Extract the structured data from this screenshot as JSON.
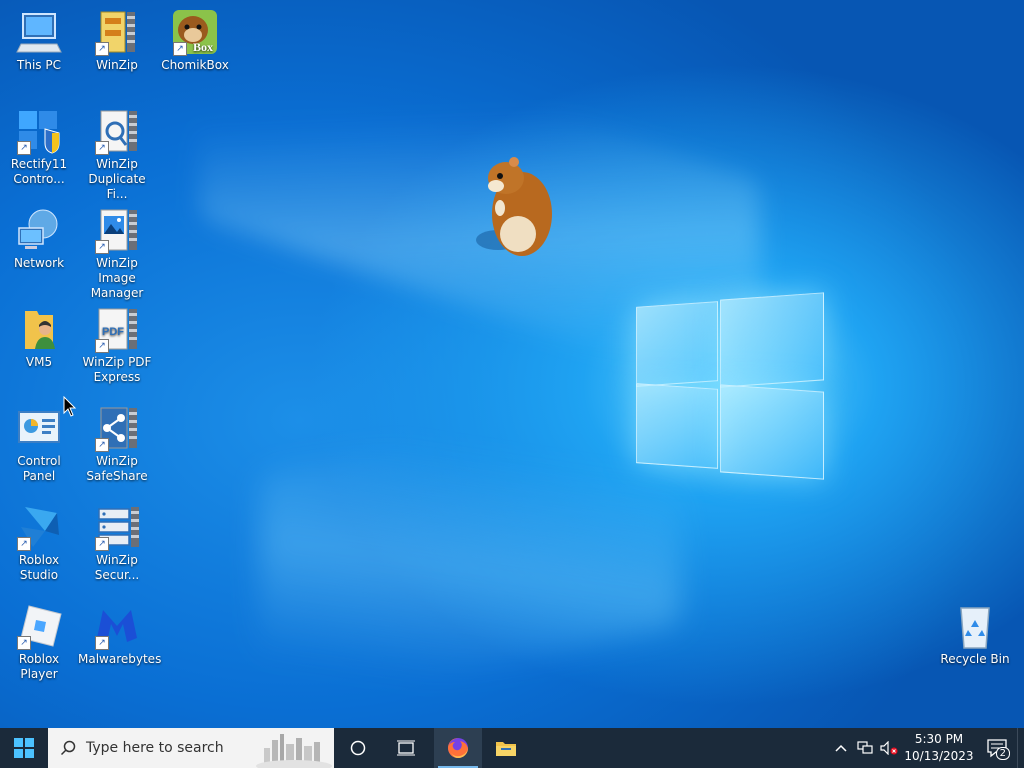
{
  "desktop": {
    "icons": [
      {
        "id": "this-pc",
        "label": "This PC"
      },
      {
        "id": "winzip",
        "label": "WinZip"
      },
      {
        "id": "chomikbox",
        "label": "ChomikBox",
        "badge": "Box"
      },
      {
        "id": "rectify11",
        "label": "Rectify11 Contro..."
      },
      {
        "id": "winzip-duplicate",
        "label": "WinZip Duplicate Fi..."
      },
      {
        "id": "network",
        "label": "Network"
      },
      {
        "id": "winzip-image",
        "label": "WinZip Image Manager"
      },
      {
        "id": "vm5",
        "label": "VM5"
      },
      {
        "id": "winzip-pdf",
        "label": "WinZip PDF Express",
        "badge": "PDF"
      },
      {
        "id": "control-panel",
        "label": "Control Panel"
      },
      {
        "id": "winzip-safeshare",
        "label": "WinZip SafeShare"
      },
      {
        "id": "roblox-studio",
        "label": "Roblox Studio"
      },
      {
        "id": "winzip-secure",
        "label": "WinZip Secur..."
      },
      {
        "id": "roblox-player",
        "label": "Roblox Player"
      },
      {
        "id": "malwarebytes",
        "label": "Malwarebytes"
      },
      {
        "id": "recycle-bin",
        "label": "Recycle Bin"
      }
    ]
  },
  "taskbar": {
    "search_placeholder": "Type here to search",
    "pinned": [
      "cortana-icon",
      "task-view-icon",
      "firefox-icon",
      "file-explorer-icon"
    ],
    "clock": {
      "time": "5:30 PM",
      "date": "10/13/2023"
    },
    "notification_count": "2"
  },
  "colors": {
    "taskbar": "#1b2a3a",
    "search_bg": "#f3f3f3",
    "accent": "#76b9ed"
  }
}
